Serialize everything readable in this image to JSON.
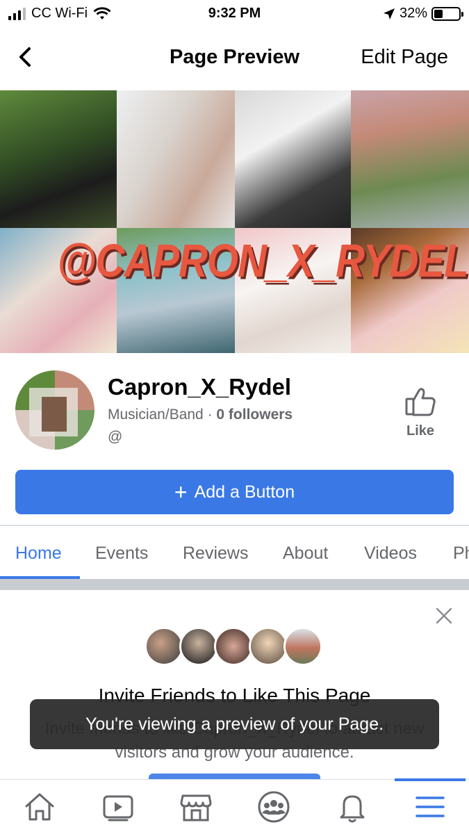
{
  "status_bar": {
    "carrier": "CC Wi-Fi",
    "time": "9:32 PM",
    "battery": "32%"
  },
  "nav": {
    "title": "Page Preview",
    "edit_label": "Edit Page"
  },
  "cover": {
    "overlay_text": "@CAPRON_X_RYDEL"
  },
  "profile": {
    "name": "Capron_X_Rydel",
    "category": "Musician/Band · ",
    "followers": "0 followers",
    "handle": "@",
    "like_label": "Like"
  },
  "add_button_label": "Add a Button",
  "tabs": [
    {
      "label": "Home"
    },
    {
      "label": "Events"
    },
    {
      "label": "Reviews"
    },
    {
      "label": "About"
    },
    {
      "label": "Videos"
    },
    {
      "label": "Ph"
    }
  ],
  "invite": {
    "title": "Invite Friends to Like This Page",
    "body": "Invite friends to like Capron_X_Rydel to attract new visitors and grow your audience."
  },
  "toast": "You're viewing a preview of your Page.",
  "colors": {
    "accent": "#3a78e6",
    "muted_text": "#65676b"
  },
  "bottom_nav": [
    "home-icon",
    "watch-icon",
    "marketplace-icon",
    "groups-icon",
    "notifications-icon",
    "menu-icon"
  ]
}
